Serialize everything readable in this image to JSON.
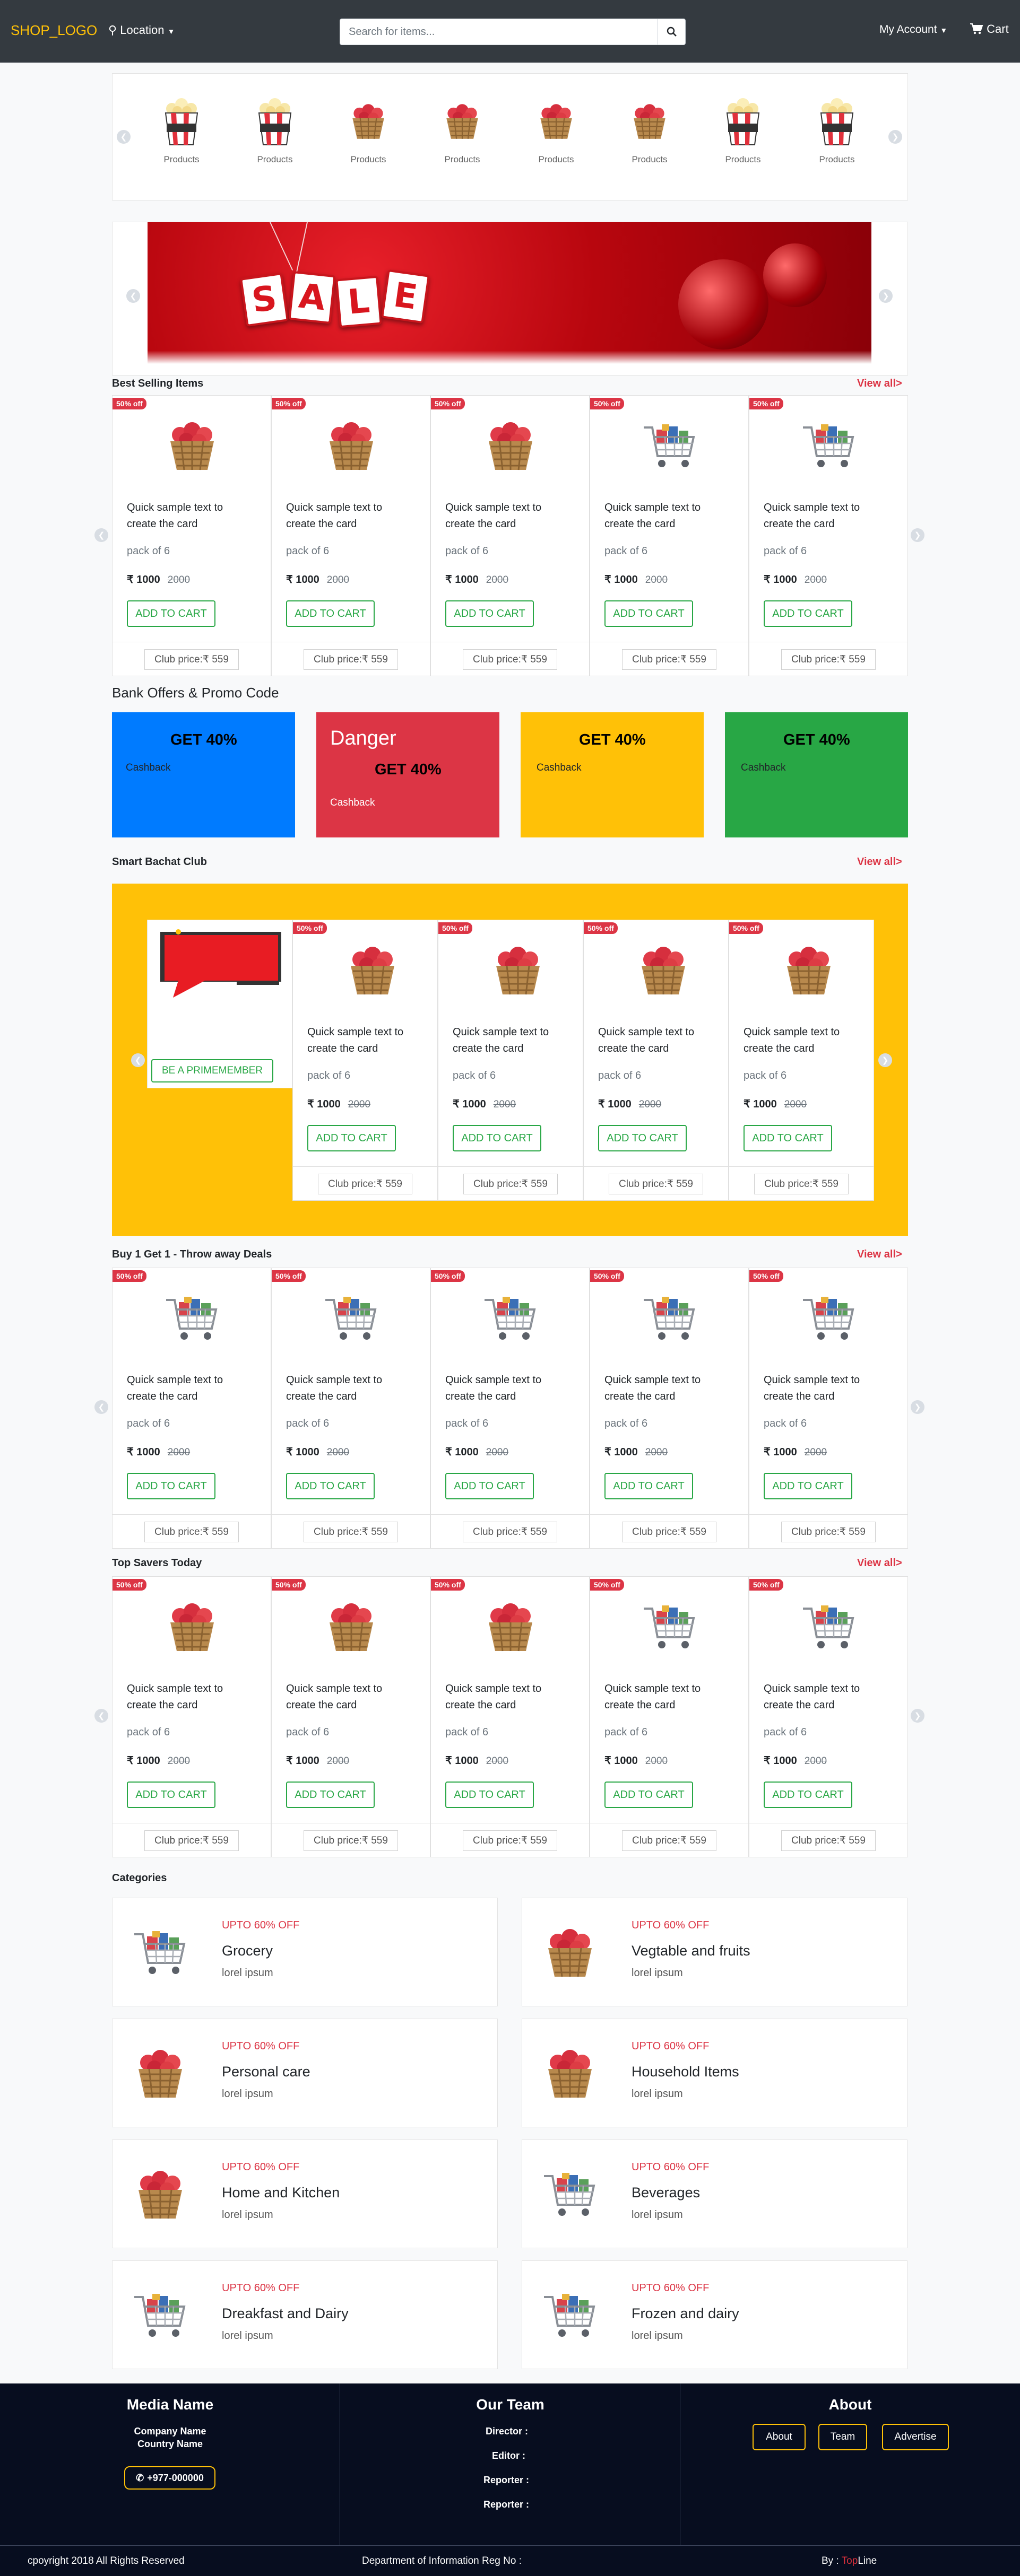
{
  "nav": {
    "logo": "SHOP_LOGO",
    "location": "Location",
    "search_placeholder": "Search for items...",
    "account": "My Account",
    "cart": "Cart"
  },
  "products_strip": {
    "items": [
      {
        "label": "Products",
        "icon": "popcorn-icon"
      },
      {
        "label": "Products",
        "icon": "popcorn-icon"
      },
      {
        "label": "Products",
        "icon": "fruit-basket-icon"
      },
      {
        "label": "Products",
        "icon": "fruit-basket-icon"
      },
      {
        "label": "Products",
        "icon": "fruit-basket-icon"
      },
      {
        "label": "Products",
        "icon": "fruit-basket-icon"
      },
      {
        "label": "Products",
        "icon": "popcorn-icon"
      },
      {
        "label": "Products",
        "icon": "popcorn-icon"
      }
    ]
  },
  "banner": {
    "letters": [
      "S",
      "A",
      "L",
      "E"
    ]
  },
  "card_text": {
    "badge": "50% off",
    "title": "Quick sample text to create the card",
    "pack": "pack of 6",
    "price": "₹ 1000",
    "old_price": "2000",
    "button": "ADD TO CART",
    "club": "Club price:₹ 559"
  },
  "best_selling": {
    "title": "Best Selling Items",
    "view_all": "View all>",
    "images": [
      "fruit-basket-icon",
      "fruit-basket-icon",
      "fruit-basket-icon",
      "shopping-cart-icon",
      "shopping-cart-icon"
    ]
  },
  "offers": {
    "title": "Bank Offers & Promo Code",
    "cards": [
      {
        "headline": "GET 40%",
        "sub": "Cashback",
        "color": "#007bff"
      },
      {
        "label": "Danger",
        "headline": "GET 40%",
        "sub": "Cashback",
        "color": "#dc3545"
      },
      {
        "headline": "GET 40%",
        "sub": "Cashback",
        "color": "#ffc107"
      },
      {
        "headline": "GET 40%",
        "sub": "Cashback",
        "color": "#28a745"
      }
    ]
  },
  "club": {
    "title": "Smart Bachat Club",
    "view_all": "View all>",
    "promo_button": "BE A PRIMEMEMBER",
    "images": [
      "fruit-basket-icon",
      "fruit-basket-icon",
      "fruit-basket-icon",
      "fruit-basket-icon"
    ]
  },
  "bogo": {
    "title": "Buy 1 Get 1 - Throw away Deals",
    "view_all": "View all>",
    "images": [
      "shopping-cart-icon",
      "shopping-cart-icon",
      "shopping-cart-icon",
      "shopping-cart-icon",
      "shopping-cart-icon"
    ]
  },
  "top_savers": {
    "title": "Top Savers Today",
    "view_all": "View all>",
    "images": [
      "fruit-basket-icon",
      "fruit-basket-icon",
      "fruit-basket-icon",
      "shopping-cart-icon",
      "shopping-cart-icon"
    ]
  },
  "categories": {
    "title": "Categories",
    "items": [
      {
        "upto": "UPTO 60% OFF",
        "name": "Grocery",
        "desc": "lorel ipsum",
        "icon": "shopping-cart-icon"
      },
      {
        "upto": "UPTO 60% OFF",
        "name": "Vegtable and fruits",
        "desc": "lorel ipsum",
        "icon": "fruit-basket-icon"
      },
      {
        "upto": "UPTO 60% OFF",
        "name": "Personal care",
        "desc": "lorel ipsum",
        "icon": "fruit-basket-icon"
      },
      {
        "upto": "UPTO 60% OFF",
        "name": "Household Items",
        "desc": "lorel ipsum",
        "icon": "fruit-basket-icon"
      },
      {
        "upto": "UPTO 60% OFF",
        "name": "Home and Kitchen",
        "desc": "lorel ipsum",
        "icon": "fruit-basket-icon"
      },
      {
        "upto": "UPTO 60% OFF",
        "name": "Beverages",
        "desc": "lorel ipsum",
        "icon": "shopping-cart-icon"
      },
      {
        "upto": "UPTO 60% OFF",
        "name": "Dreakfast and Dairy",
        "desc": "lorel ipsum",
        "icon": "shopping-cart-icon"
      },
      {
        "upto": "UPTO 60% OFF",
        "name": "Frozen and dairy",
        "desc": "lorel ipsum",
        "icon": "shopping-cart-icon"
      }
    ]
  },
  "footer": {
    "media": {
      "title": "Media Name",
      "company": "Company Name",
      "country": "Country Name",
      "phone": "+977-000000"
    },
    "team": {
      "title": "Our Team",
      "roles": [
        "Director :",
        "Editor :",
        "Reporter :",
        "Reporter :"
      ]
    },
    "about": {
      "title": "About",
      "buttons": [
        "About",
        "Team",
        "Advertise"
      ]
    },
    "copyright": "cpoyright 2018 All Rights Reserved",
    "reg": "Department of Information Reg No :",
    "by_prefix": "By : ",
    "by_top": "Top",
    "by_line": "Line"
  }
}
